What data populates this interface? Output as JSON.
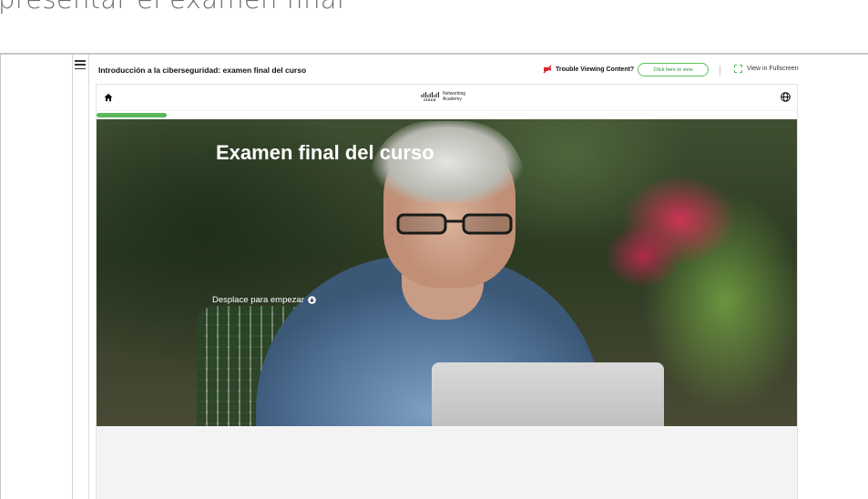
{
  "page_heading": "presentar el examen final",
  "header": {
    "course_title": "Introducción a la ciberseguridad: examen final del curso",
    "trouble_text": "Trouble Viewing Content?",
    "click_button_label": "Click here to view",
    "fullscreen_label": "View in Fullscreen"
  },
  "module": {
    "brand_cisco": "cisco",
    "brand_line1": "Networking",
    "brand_line2": "Academy",
    "progress_fraction": 0.1
  },
  "hero": {
    "title": "Examen final del curso",
    "scroll_label": "Desplace para empezar"
  },
  "colors": {
    "accent_green": "#5cb85c",
    "trouble_icon_red": "#d9232e",
    "button_border": "#5bc25b"
  }
}
